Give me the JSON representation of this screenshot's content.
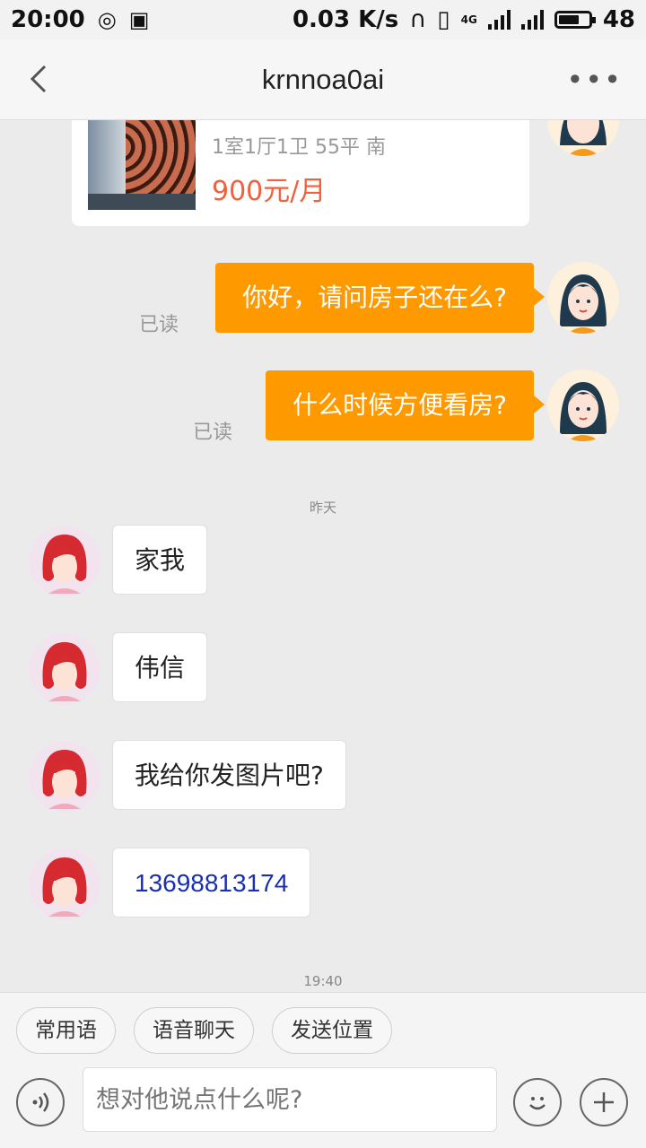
{
  "status_bar": {
    "time": "20:00",
    "net_speed": "0.03 K/s",
    "network": "4G",
    "battery": "48"
  },
  "header": {
    "title": "krnnoa0ai"
  },
  "listing": {
    "meta": "1室1厅1卫 55平 南",
    "price": "900元/月"
  },
  "messages_out": [
    {
      "text": "你好，请问房子还在么?",
      "status": "已读"
    },
    {
      "text": "什么时候方便看房?",
      "status": "已读"
    }
  ],
  "separators": {
    "yesterday": "昨天",
    "time": "19:40"
  },
  "messages_in": [
    {
      "text": "家我"
    },
    {
      "text": "伟信"
    },
    {
      "text": "我给你发图片吧?"
    },
    {
      "text": "13698813174"
    }
  ],
  "quick_actions": [
    "常用语",
    "语音聊天",
    "发送位置"
  ],
  "input": {
    "placeholder": "想对他说点什么呢?"
  },
  "colors": {
    "accent": "#ff9900",
    "price": "#f2603c",
    "phone_link": "#1a2fb0"
  }
}
